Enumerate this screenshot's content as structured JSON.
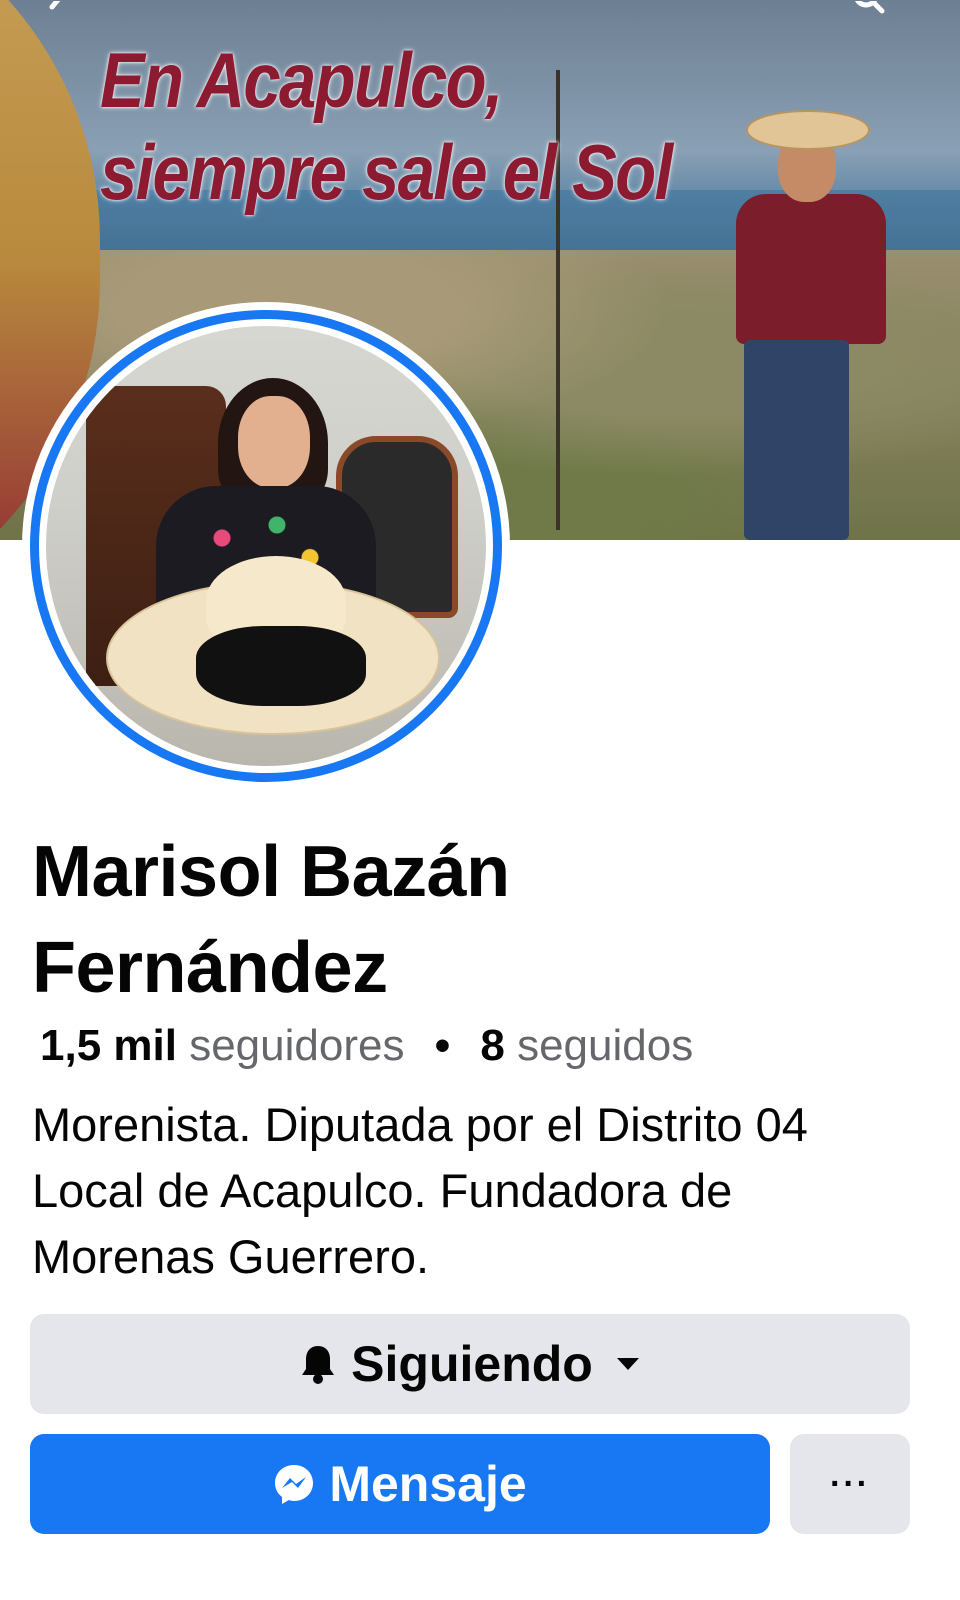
{
  "cover": {
    "slogan_line1": "En Acapulco,",
    "slogan_line2": "siempre sale el Sol"
  },
  "profile": {
    "name_line1": "Marisol Bazán",
    "name_line2": "Fernández",
    "followers_count": "1,5 mil",
    "followers_label": "seguidores",
    "separator": "•",
    "following_count": "8",
    "following_label": "seguidos",
    "bio": "Morenista. Diputada por el Distrito 04 Local de Acapulco. Fundadora de Morenas Guerrero."
  },
  "actions": {
    "following_label": "Siguiendo",
    "message_label": "Mensaje",
    "more_label": "···"
  },
  "icons": {
    "following": "bell-icon",
    "following_menu": "caret-down-icon",
    "message": "messenger-icon",
    "more": "more-icon"
  },
  "colors": {
    "accent": "#1877f2",
    "button_secondary": "#e4e6eb",
    "secondary_text": "#65676b",
    "slogan": "#8c1a30"
  }
}
